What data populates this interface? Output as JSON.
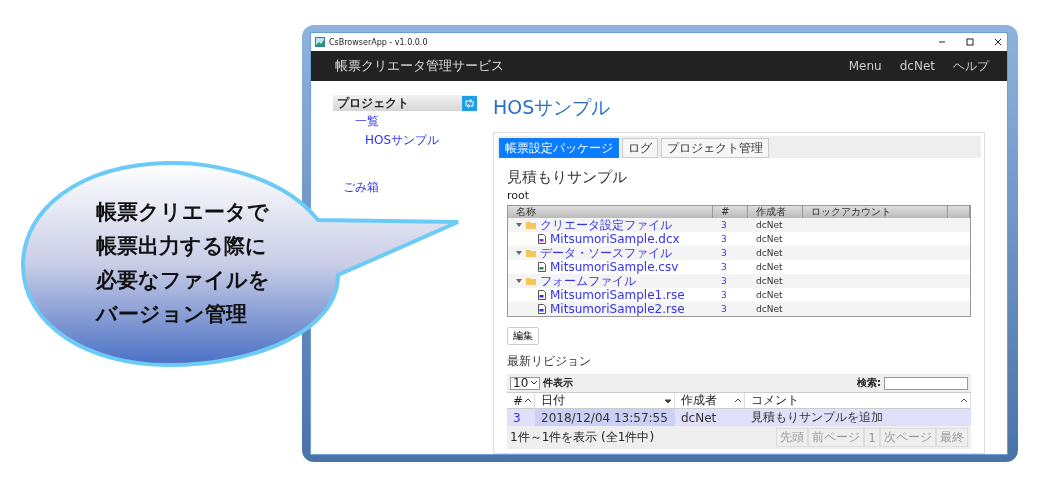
{
  "window": {
    "title": "CsBrowserApp - v1.0.0.0"
  },
  "navbar": {
    "brand": "帳票クリエータ管理サービス",
    "links": [
      "Menu",
      "dcNet",
      "ヘルプ"
    ]
  },
  "sidebar": {
    "heading": "プロジェクト",
    "items": [
      {
        "label": "一覧",
        "children": [
          {
            "label": "HOSサンプル"
          }
        ]
      }
    ],
    "trash": "ごみ箱"
  },
  "page_title": "HOSサンプル",
  "tabs": [
    {
      "label": "帳票設定パッケージ",
      "selected": true
    },
    {
      "label": "ログ",
      "selected": false
    },
    {
      "label": "プロジェクト管理",
      "selected": false
    }
  ],
  "package": {
    "title": "見積もりサンプル",
    "path": "root"
  },
  "tree": {
    "columns": [
      "名称",
      "#",
      "作成者",
      "ロックアカウント"
    ],
    "rows": [
      {
        "kind": "folder",
        "name": "クリエータ設定ファイル",
        "rev": "3",
        "author": "dcNet",
        "expanded": true,
        "children": [
          {
            "kind": "dcx",
            "name": "MitsumoriSample.dcx",
            "rev": "3",
            "author": "dcNet"
          }
        ]
      },
      {
        "kind": "folder",
        "name": "データ・ソースファイル",
        "rev": "3",
        "author": "dcNet",
        "expanded": true,
        "children": [
          {
            "kind": "csv",
            "name": "MitsumoriSample.csv",
            "rev": "3",
            "author": "dcNet"
          }
        ]
      },
      {
        "kind": "folder",
        "name": "フォームファイル",
        "rev": "3",
        "author": "dcNet",
        "expanded": true,
        "children": [
          {
            "kind": "rse",
            "name": "MitsumoriSample1.rse",
            "rev": "3",
            "author": "dcNet"
          },
          {
            "kind": "rse",
            "name": "MitsumoriSample2.rse",
            "rev": "3",
            "author": "dcNet"
          }
        ]
      }
    ]
  },
  "edit_button": "編集",
  "revisions": {
    "title": "最新リビジョン",
    "page_size": "10",
    "page_size_label": "件表示",
    "search_label": "検索:",
    "columns": [
      "#",
      "日付",
      "作成者",
      "コメント"
    ],
    "rows": [
      {
        "cells": [
          "3",
          "2018/12/04 13:57:55",
          "dcNet",
          "見積もりサンプルを追加"
        ],
        "selected": true
      }
    ],
    "info": "1件～1件を表示 (全1件中)",
    "pager": [
      {
        "label": "先頭",
        "disabled": true
      },
      {
        "label": "前ページ",
        "disabled": true
      },
      {
        "label": "1",
        "disabled": true
      },
      {
        "label": "次ページ",
        "disabled": true
      },
      {
        "label": "最終",
        "disabled": true
      }
    ]
  },
  "callout": {
    "lines": [
      "帳票クリエータで",
      "帳票出力する際に",
      "必要なファイルを",
      "バージョン管理"
    ]
  }
}
